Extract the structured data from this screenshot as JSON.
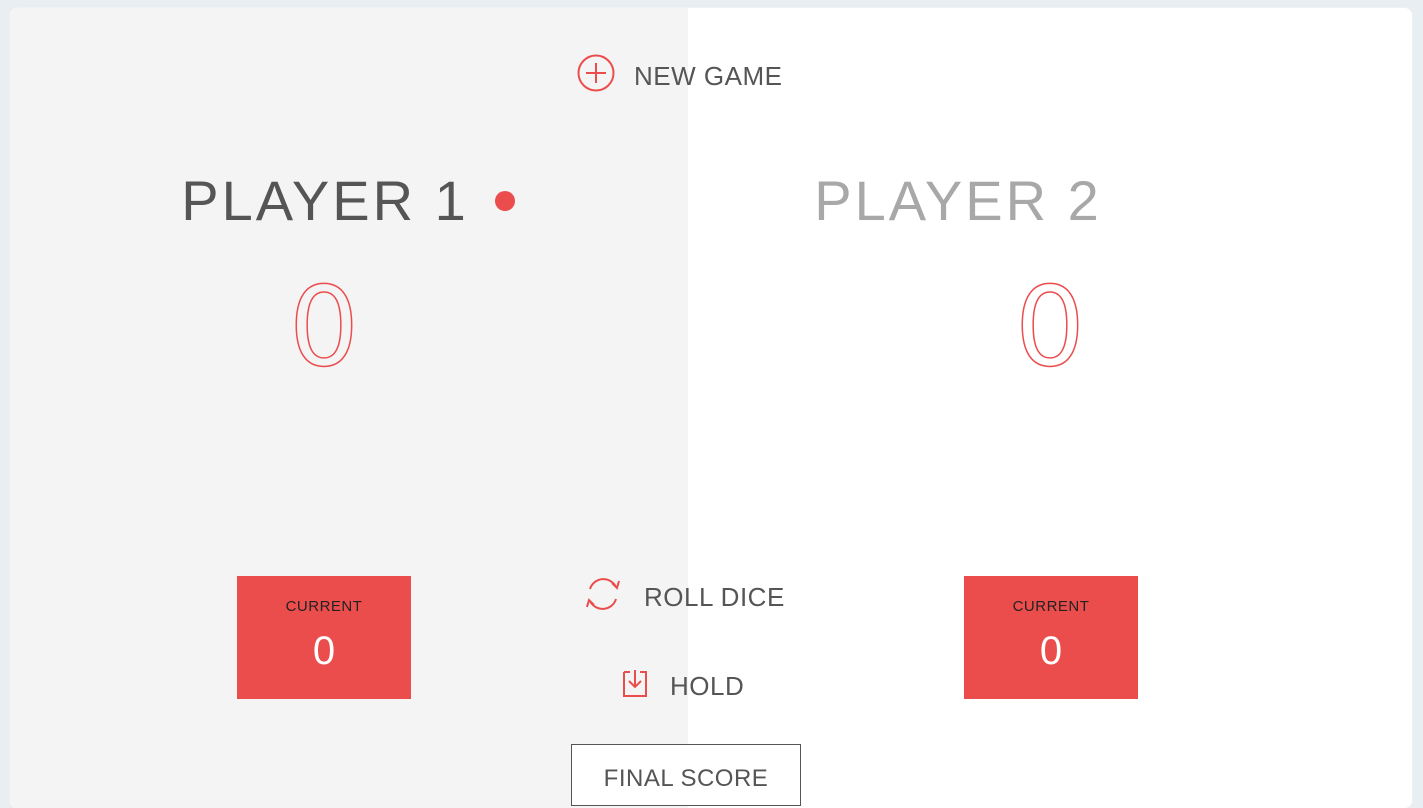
{
  "controls": {
    "new_game_label": "NEW GAME",
    "roll_dice_label": "ROLL DICE",
    "hold_label": "HOLD",
    "final_score_label": "FINAL SCORE"
  },
  "players": [
    {
      "name": "PLAYER 1",
      "score": "0",
      "current_label": "CURRENT",
      "current_score": "0",
      "active": true
    },
    {
      "name": "PLAYER 2",
      "score": "0",
      "current_label": "CURRENT",
      "current_score": "0",
      "active": false
    }
  ],
  "icons": {
    "new_game": "plus-circle-icon",
    "roll_dice": "refresh-icon",
    "hold": "download-icon",
    "active_player": "dot-icon"
  },
  "colors": {
    "accent": "#eb4d4d",
    "active_panel_bg": "#f4f4f4",
    "inactive_panel_bg": "#ffffff",
    "text": "#555555",
    "inactive_text": "#a8a8a8"
  }
}
